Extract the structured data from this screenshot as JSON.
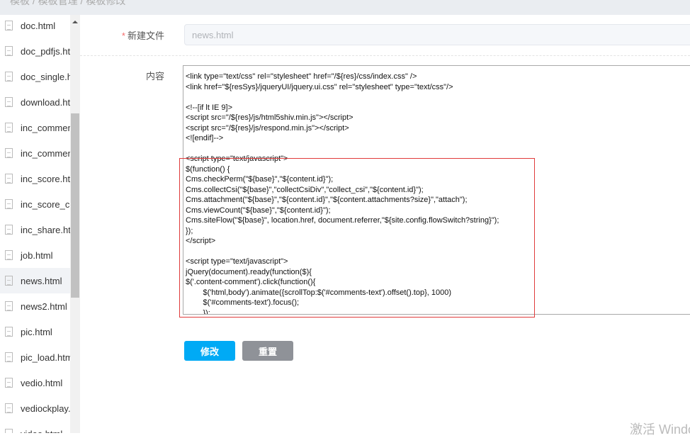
{
  "breadcrumb": [
    "模板",
    "模板管理",
    "模板修改"
  ],
  "sidebar": {
    "items": [
      "doc.html",
      "doc_pdfjs.html",
      "doc_single.html",
      "download.html",
      "inc_comment.html",
      "inc_comment_list.html",
      "inc_score.html",
      "inc_score_common.html",
      "inc_share.html",
      "job.html",
      "news.html",
      "news2.html",
      "pic.html",
      "pic_load.html",
      "vedio.html",
      "vediockplay.html",
      "video.html"
    ],
    "active": "news.html"
  },
  "form": {
    "filename_label": "新建文件",
    "filename_value": "news.html",
    "content_label": "内容",
    "content_lines": [
      "<link type=\"text/css\" rel=\"stylesheet\" href=\"/${res}/css/index.css\" />",
      "<link href=\"${resSys}/jqueryUI/jquery.ui.css\" rel=\"stylesheet\" type=\"text/css\"/>",
      "",
      "<!--[if lt IE 9]>",
      "<script src=\"/${res}/js/html5shiv.min.js\"></script>",
      "<script src=\"/${res}/js/respond.min.js\"></script>",
      "<![endif]-->",
      "",
      "<script type=\"text/javascript\">",
      "$(function() {",
      "Cms.checkPerm(\"${base}\",\"${content.id}\");",
      "Cms.collectCsi(\"${base}\",\"collectCsiDiv\",\"collect_csi\",\"${content.id}\");",
      "Cms.attachment(\"${base}\",\"${content.id}\",\"${content.attachments?size}\",\"attach\");",
      "Cms.viewCount(\"${base}\",\"${content.id}\");",
      "Cms.siteFlow(\"${base}\", location.href, document.referrer,\"${site.config.flowSwitch?string}\");",
      "});",
      "</script>",
      "",
      "<script type=\"text/javascript\">",
      "jQuery(document).ready(function($){",
      "$('.content-comment').click(function(){",
      "        $('html,body').animate({scrollTop:$('#comments-text').offset().top}, 1000)",
      "        $('#comments-text').focus();",
      "        });",
      "});"
    ],
    "submit_label": "修改",
    "reset_label": "重置"
  },
  "watermark": "激活 Windows",
  "colors": {
    "primary": "#00aaf5",
    "reset": "#8f9298",
    "highlight": "#e03b3b"
  }
}
